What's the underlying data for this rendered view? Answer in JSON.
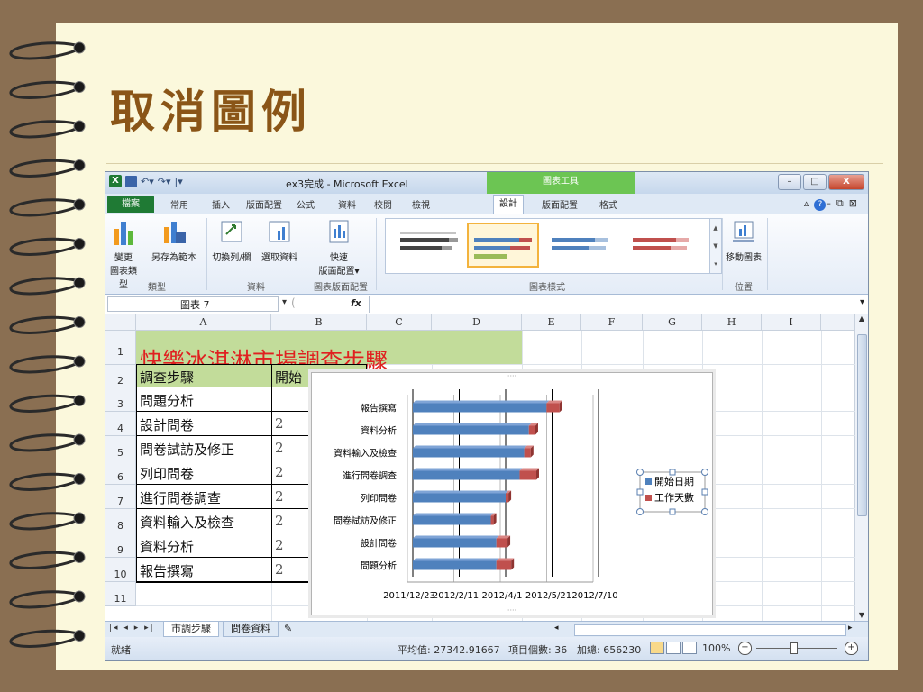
{
  "slide": {
    "title": "取消圖例"
  },
  "window": {
    "title": "ex3完成 - Microsoft Excel",
    "context_tab": "圖表工具",
    "min": "–",
    "max": "□",
    "close": "X"
  },
  "tabs": {
    "file": "檔案",
    "items": [
      "常用",
      "插入",
      "版面配置",
      "公式",
      "資料",
      "校閱",
      "檢視"
    ],
    "active": "設計",
    "context_items": [
      "版面配置",
      "格式"
    ]
  },
  "ribbon": {
    "change_type_1": "變更",
    "change_type_2": "圖表類型",
    "save_template": "另存為範本",
    "switch_rowcol": "切換列/欄",
    "select_data": "選取資料",
    "quick_layout_1": "快速",
    "quick_layout_2": "版面配置",
    "move_chart": "移動圖表",
    "groups": {
      "type": "類型",
      "data": "資料",
      "layout": "圖表版面配置",
      "styles": "圖表樣式",
      "location": "位置"
    }
  },
  "formula_bar": {
    "name_box": "圖表 7",
    "fx": "fx"
  },
  "columns": [
    "A",
    "B",
    "C",
    "D",
    "E",
    "F",
    "G",
    "H",
    "I"
  ],
  "rows": [
    "1",
    "2",
    "3",
    "4",
    "5",
    "6",
    "7",
    "8",
    "9",
    "10",
    "11"
  ],
  "sheet": {
    "title_cell": "快樂冰淇淋市場調查步驟",
    "header_a": "調查步驟",
    "header_b": "開始",
    "col_a": [
      "問題分析",
      "設計問卷",
      "問卷試訪及修正",
      "列印問卷",
      "進行問卷調查",
      "資料輸入及檢查",
      "資料分析",
      "報告撰寫"
    ],
    "col_b_partial": [
      "",
      "2",
      "2",
      "2",
      "2",
      "2",
      "2",
      "2"
    ]
  },
  "sheet_tabs": [
    "市調步驟",
    "問卷資料"
  ],
  "status": {
    "ready": "就緒",
    "average": "平均值: 27342.91667",
    "count": "項目個數: 36",
    "sum": "加總: 656230",
    "zoom": "100%"
  },
  "chart_data": {
    "type": "bar",
    "stacked": true,
    "categories": [
      "問題分析",
      "設計問卷",
      "問卷試訪及修正",
      "列印問卷",
      "進行問卷調查",
      "資料輸入及檢查",
      "資料分析",
      "報告撰寫"
    ],
    "x_ticks": [
      "2011/12/23",
      "2012/2/11",
      "2012/4/1",
      "2012/5/21",
      "2012/7/10"
    ],
    "xlim": [
      "2011/12/23",
      "2012/7/10"
    ],
    "series": [
      {
        "name": "開始日期",
        "color": "#4f81bd",
        "values": [
          "2012/3/22",
          "2012/3/22",
          "2012/3/16",
          "2012/4/1",
          "2012/4/16",
          "2012/4/21",
          "2012/4/26",
          "2012/5/15"
        ]
      },
      {
        "name": "工作天數",
        "color": "#c0504d",
        "values": [
          16,
          12,
          3,
          3,
          18,
          7,
          7,
          14
        ]
      }
    ],
    "legend": "right",
    "legend_selected": true,
    "grid": true
  }
}
